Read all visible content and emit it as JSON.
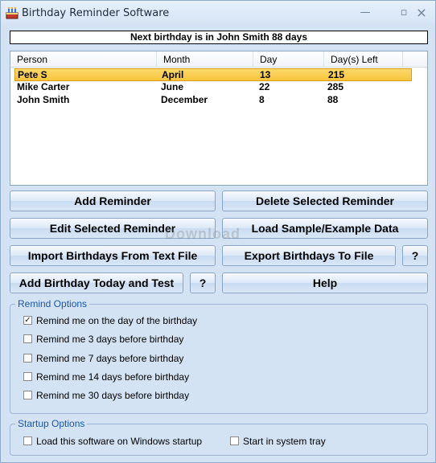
{
  "window": {
    "title": "Birthday Reminder Software"
  },
  "banner": {
    "text": "Next birthday is in John Smith 88 days"
  },
  "list": {
    "columns": [
      "Person",
      "Month",
      "Day",
      "Day(s) Left"
    ],
    "rows": [
      {
        "person": "Pete S",
        "month": "April",
        "day": "13",
        "left": "215",
        "selected": true
      },
      {
        "person": "Mike Carter",
        "month": "June",
        "day": "22",
        "left": "285",
        "selected": false
      },
      {
        "person": "John Smith",
        "month": "December",
        "day": "8",
        "left": "88",
        "selected": false
      }
    ]
  },
  "buttons": {
    "add_reminder": "Add Reminder",
    "delete_selected": "Delete Selected Reminder",
    "edit_selected": "Edit Selected Reminder",
    "load_sample": "Load Sample/Example Data",
    "import_birthdays": "Import Birthdays From Text File",
    "export_birthdays": "Export Birthdays To File",
    "export_help": "?",
    "add_today_test": "Add Birthday Today and Test",
    "test_help": "?",
    "help": "Help"
  },
  "remind_options": {
    "legend": "Remind Options",
    "items": [
      {
        "label": "Remind me on the day of the birthday",
        "checked": true
      },
      {
        "label": "Remind me 3 days before birthday",
        "checked": false
      },
      {
        "label": "Remind me 7 days before birthday",
        "checked": false
      },
      {
        "label": "Remind me 14 days before birthday",
        "checked": false
      },
      {
        "label": "Remind me 30 days before birthday",
        "checked": false
      }
    ]
  },
  "startup_options": {
    "legend": "Startup Options",
    "load_on_startup": {
      "label": "Load this software on Windows startup",
      "checked": false
    },
    "start_in_tray": {
      "label": "Start in system tray",
      "checked": false
    }
  },
  "watermark": {
    "text": "Download"
  },
  "colors": {
    "selection": "#f7c53b",
    "legend": "#1c56a6",
    "window_bg": "#d3e3f4"
  }
}
